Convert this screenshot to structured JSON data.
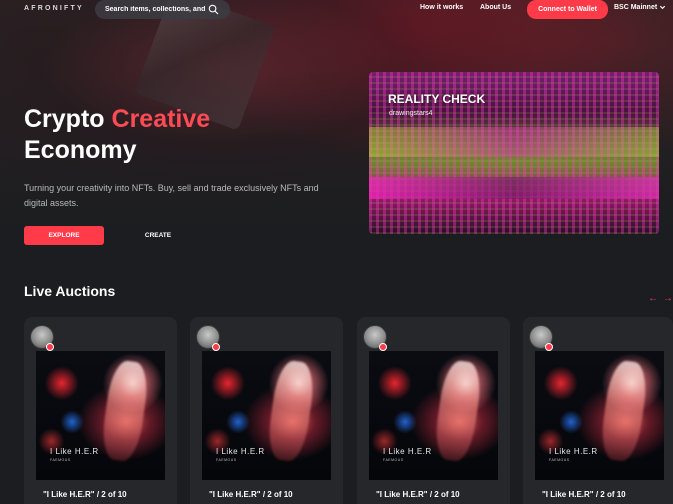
{
  "nav": {
    "logo": "AFRONIFTY",
    "search_placeholder": "Search items, collections, and",
    "links": [
      "How it works",
      "About Us"
    ],
    "connect_label": "Connect to Wallet",
    "network_label": "BSC Mainnet"
  },
  "hero": {
    "title_part1": "Crypto",
    "title_accent": "Creative",
    "title_part2": "Economy",
    "subtitle": "Turning your creativity into NFTs. Buy, sell and trade exclusively NFTs and digital assets.",
    "explore_label": "EXPLORE",
    "create_label": "CREATE",
    "accent_color": "#ff3b4a"
  },
  "featured": {
    "title": "REALITY CHECK",
    "artist": "drawingstars4"
  },
  "live_auctions": {
    "heading": "Live Auctions",
    "prev_icon": "←",
    "next_icon": "→",
    "cards": [
      {
        "title": "\"I Like H.E.R\" / 2 of 10",
        "art_label": "I Like H.E.R",
        "art_sub": "FAEMOUS"
      },
      {
        "title": "\"I Like H.E.R\" / 2 of 10",
        "art_label": "I Like H.E.R",
        "art_sub": "FAEMOUS"
      },
      {
        "title": "\"I Like H.E.R\" / 2 of 10",
        "art_label": "I Like H.E.R",
        "art_sub": "FAEMOUS"
      },
      {
        "title": "\"I Like H.E.R\" / 2 of 10",
        "art_label": "I Like H.E.R",
        "art_sub": "FAEMOUS"
      }
    ]
  }
}
